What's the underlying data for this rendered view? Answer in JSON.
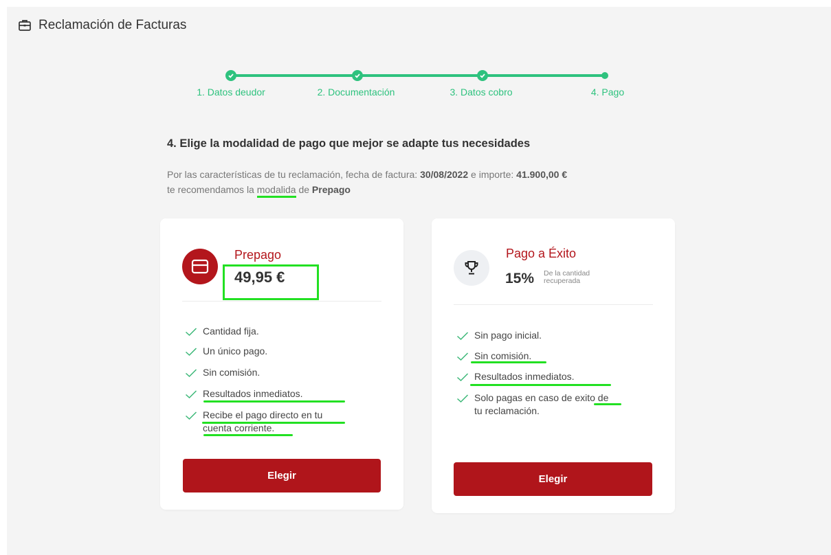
{
  "header": {
    "title": "Reclamación de Facturas",
    "icon": "briefcase-icon"
  },
  "stepper": {
    "steps": [
      {
        "label": "1. Datos deudor",
        "done": true
      },
      {
        "label": "2. Documentación",
        "done": true
      },
      {
        "label": "3. Datos cobro",
        "done": true
      },
      {
        "label": "4. Pago",
        "done": false,
        "current": true
      }
    ],
    "color": "#2ec27e"
  },
  "section": {
    "title": "4. Elige la modalidad de pago que mejor se adapte tus necesidades",
    "desc_prefix": "Por las características de tu reclamación, fecha de factura: ",
    "invoice_date": "30/08/2022",
    "desc_mid": " e importe: ",
    "amount": "41.900,00 €",
    "desc_line2_prefix": "te recomendamos la ",
    "word_modalida": "modalida",
    "desc_line2_mid": " de ",
    "recommended": "Prepago"
  },
  "plans": [
    {
      "name": "Prepago",
      "price": "49,95 €",
      "icon": "credit-card-icon",
      "features": [
        "Cantidad fija.",
        "Un único pago.",
        "Sin comisión.",
        "Resultados inmediatos.",
        "Recibe el pago directo en tu cuenta corriente."
      ],
      "button": "Elegir"
    },
    {
      "name": "Pago a Éxito",
      "percent": "15%",
      "percent_note": "De la cantidad recuperada",
      "icon": "trophy-icon",
      "features": [
        "Sin pago inicial.",
        "Sin comisión.",
        "Resultados inmediatos.",
        "Solo pagas en caso de exito de tu reclamación."
      ],
      "button": "Elegir"
    }
  ],
  "colors": {
    "brand_red": "#b0151b",
    "accent_green": "#2ec27e",
    "annotation_green": "#22e022"
  }
}
